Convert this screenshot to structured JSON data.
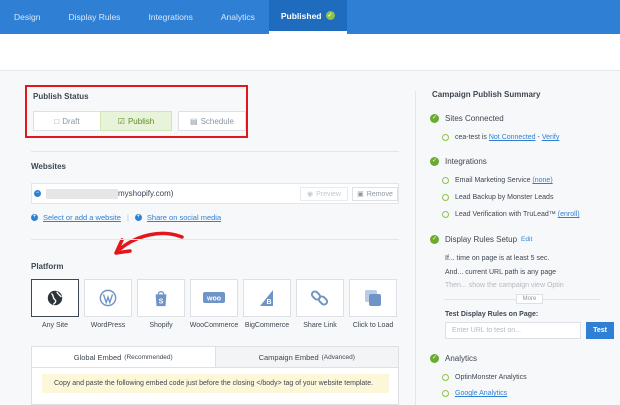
{
  "nav": {
    "tabs": [
      {
        "label": "Design"
      },
      {
        "label": "Display Rules"
      },
      {
        "label": "Integrations"
      },
      {
        "label": "Analytics"
      },
      {
        "label": "Published"
      }
    ]
  },
  "publish_status": {
    "title": "Publish Status",
    "draft": "Draft",
    "publish": "Publish",
    "schedule": "Schedule",
    "active": "publish"
  },
  "websites": {
    "title": "Websites",
    "site_domain": "myshopify.com)",
    "preview_label": "Preview",
    "remove_label": "Remove",
    "add_link": "Select or add a website",
    "share_link": "Share on social media"
  },
  "platform": {
    "title": "Platform",
    "items": [
      {
        "label": "Any Site",
        "icon": "globe-icon"
      },
      {
        "label": "WordPress",
        "icon": "wordpress-icon"
      },
      {
        "label": "Shopify",
        "icon": "shopify-icon"
      },
      {
        "label": "WooCommerce",
        "icon": "woocommerce-icon"
      },
      {
        "label": "BigCommerce",
        "icon": "bigcommerce-icon"
      },
      {
        "label": "Share Link",
        "icon": "link-icon"
      },
      {
        "label": "Click to Load",
        "icon": "stack-icon"
      }
    ],
    "selected": "Any Site"
  },
  "embed": {
    "tab_global": "Global Embed",
    "tab_global_note": "(Recommended)",
    "tab_campaign": "Campaign Embed",
    "tab_campaign_note": "(Advanced)",
    "note": "Copy and paste the following embed code just before the closing </body> tag of your website template."
  },
  "summary": {
    "title": "Campaign Publish Summary",
    "sites": {
      "title": "Sites Connected",
      "prefix": "cea-test is",
      "status": "Not Connected",
      "separator": "-",
      "verify": "Verify"
    },
    "integrations": {
      "title": "Integrations",
      "items": [
        {
          "text": "Email Marketing Service",
          "link": "(none)"
        },
        {
          "text": "Lead Backup by Monster Leads",
          "link": ""
        },
        {
          "text": "Lead Verification with TruLead™",
          "link": "(enroll)"
        }
      ]
    },
    "display_rules": {
      "title": "Display Rules Setup",
      "edit": "Edit",
      "lines": [
        "If... time on page is at least 5 sec.",
        "And... current URL path is any page",
        "Then... show the campaign view Optin"
      ],
      "more": "More",
      "test_label": "Test Display Rules on Page:",
      "test_placeholder": "Enter URL to test on...",
      "test_button": "Test"
    },
    "analytics": {
      "title": "Analytics",
      "items": [
        {
          "text": "OptinMonster Analytics",
          "link": false
        },
        {
          "text": "Google Analytics",
          "link": true
        }
      ]
    }
  },
  "colors": {
    "nav_blue": "#2f80d5",
    "highlight_red": "#e2161c",
    "success_green": "#6aab2e"
  }
}
